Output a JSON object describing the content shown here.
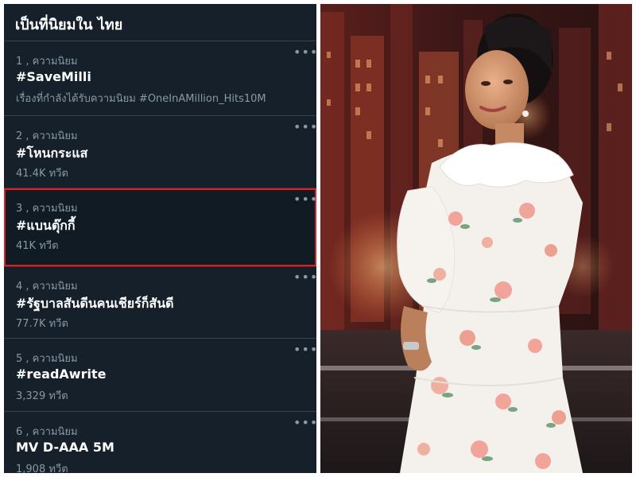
{
  "panel": {
    "title": "เป็นที่นิยมใน ไทย"
  },
  "trends": [
    {
      "rank_label": "1 , ความนิยม",
      "name": "#SaveMilli",
      "subtitle": "เรื่องที่กำลังได้รับความนิยม #OneInAMillion_Hits10M",
      "highlighted": false
    },
    {
      "rank_label": "2 , ความนิยม",
      "name": "#โหนกระแส",
      "subtitle": "41.4K ทวีต",
      "highlighted": false
    },
    {
      "rank_label": "3 , ความนิยม",
      "name": "#แบนตุ๊กกี้",
      "subtitle": "41K ทวีต",
      "highlighted": true
    },
    {
      "rank_label": "4 , ความนิยม",
      "name": "#รัฐบาลสันดีนคนเชียร์ก็สันดี",
      "subtitle": "77.7K ทวีต",
      "highlighted": false
    },
    {
      "rank_label": "5 , ความนิยม",
      "name": "#readAwrite",
      "subtitle": "3,329 ทวีต",
      "highlighted": false
    },
    {
      "rank_label": "6 , ความนิยม",
      "name": "MV D-AAA 5M",
      "subtitle": "1,908 ทวีต",
      "highlighted": false
    }
  ],
  "more_glyph": "•••",
  "colors": {
    "panel_background": "#15202b",
    "divider": "#38444d",
    "secondary_text": "#8899a6",
    "primary_text": "#ffffff",
    "highlight_border": "#d0262b"
  },
  "icons": {
    "more": "more-options-icon"
  }
}
